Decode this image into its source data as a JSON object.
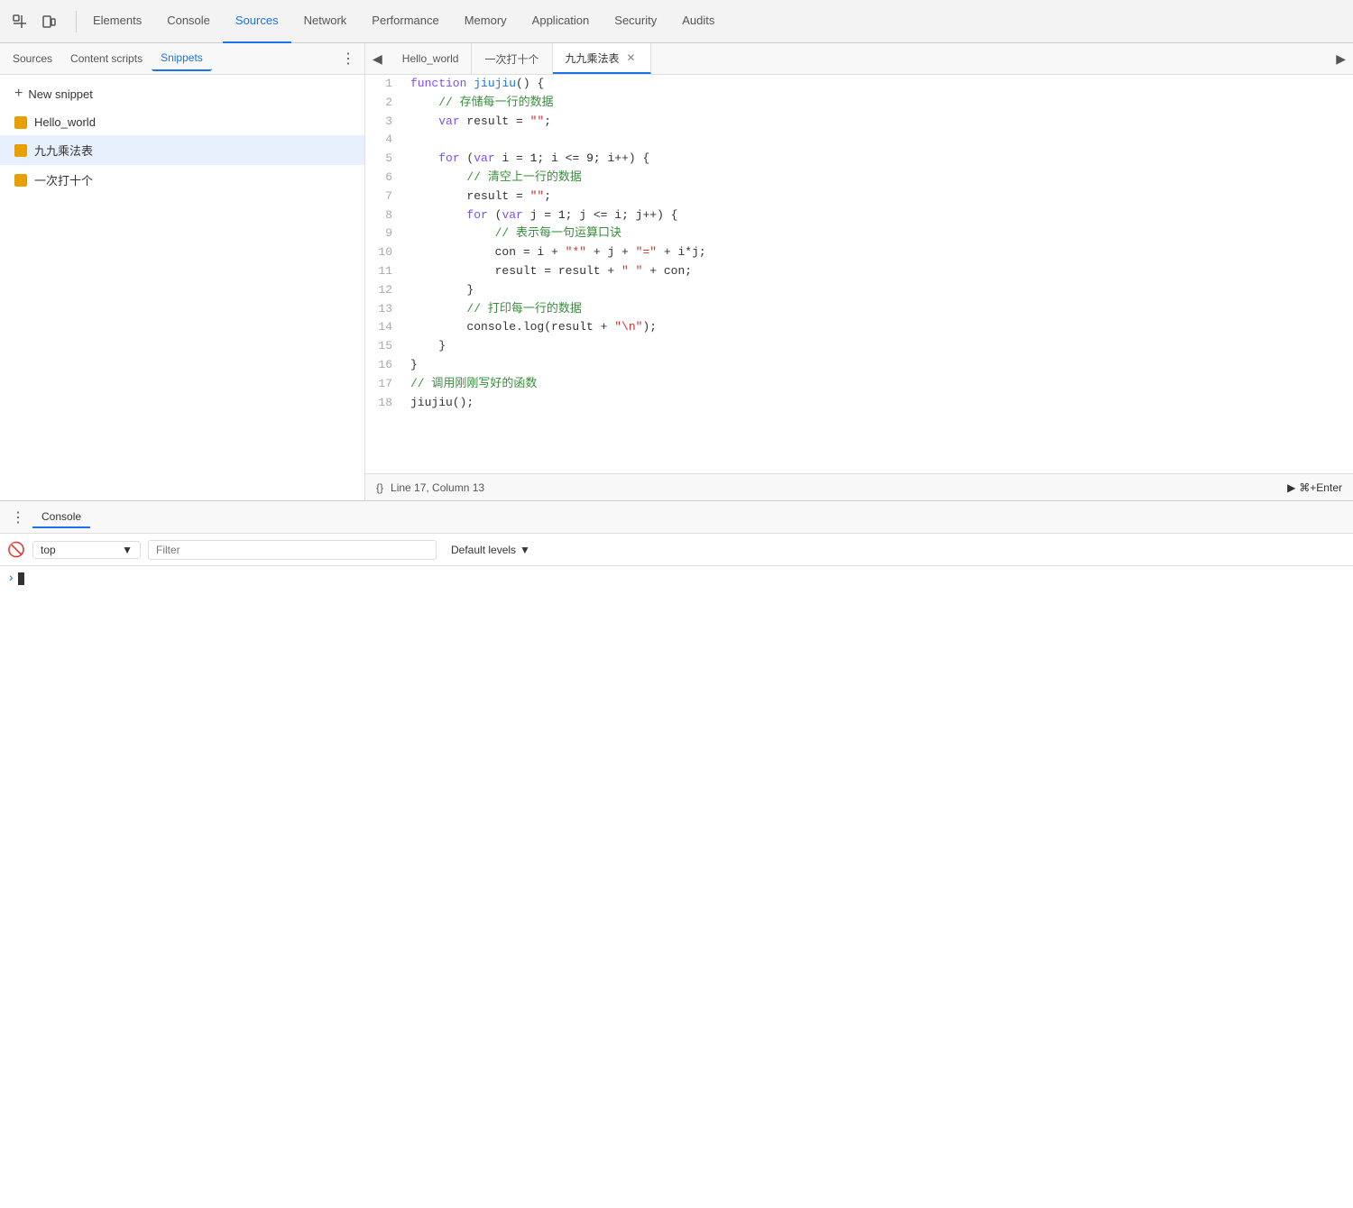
{
  "toolbar": {
    "tabs": [
      {
        "id": "elements",
        "label": "Elements",
        "active": false
      },
      {
        "id": "console",
        "label": "Console",
        "active": false
      },
      {
        "id": "sources",
        "label": "Sources",
        "active": true
      },
      {
        "id": "network",
        "label": "Network",
        "active": false
      },
      {
        "id": "performance",
        "label": "Performance",
        "active": false
      },
      {
        "id": "memory",
        "label": "Memory",
        "active": false
      },
      {
        "id": "application",
        "label": "Application",
        "active": false
      },
      {
        "id": "security",
        "label": "Security",
        "active": false
      },
      {
        "id": "audits",
        "label": "Audits",
        "active": false
      }
    ]
  },
  "left_panel": {
    "tabs": [
      {
        "label": "Sources",
        "active": false
      },
      {
        "label": "Content scripts",
        "active": false
      },
      {
        "label": "Snippets",
        "active": true
      }
    ],
    "new_snippet_label": "+ New snippet",
    "snippets": [
      {
        "name": "Hello_world",
        "active": false
      },
      {
        "name": "九九乘法表",
        "active": true
      },
      {
        "name": "一次打十个",
        "active": false
      }
    ]
  },
  "editor": {
    "tabs": [
      {
        "label": "Hello_world",
        "closeable": false,
        "active": false
      },
      {
        "label": "一次打十个",
        "closeable": false,
        "active": false
      },
      {
        "label": "九九乘法表",
        "closeable": true,
        "active": true
      }
    ],
    "status": {
      "position": "Line 17, Column 13",
      "run_label": "⌘+Enter"
    }
  },
  "console_panel": {
    "tab_label": "Console",
    "filter_placeholder": "Filter",
    "context_label": "top",
    "level_label": "Default levels",
    "clear_icon": "🚫"
  }
}
